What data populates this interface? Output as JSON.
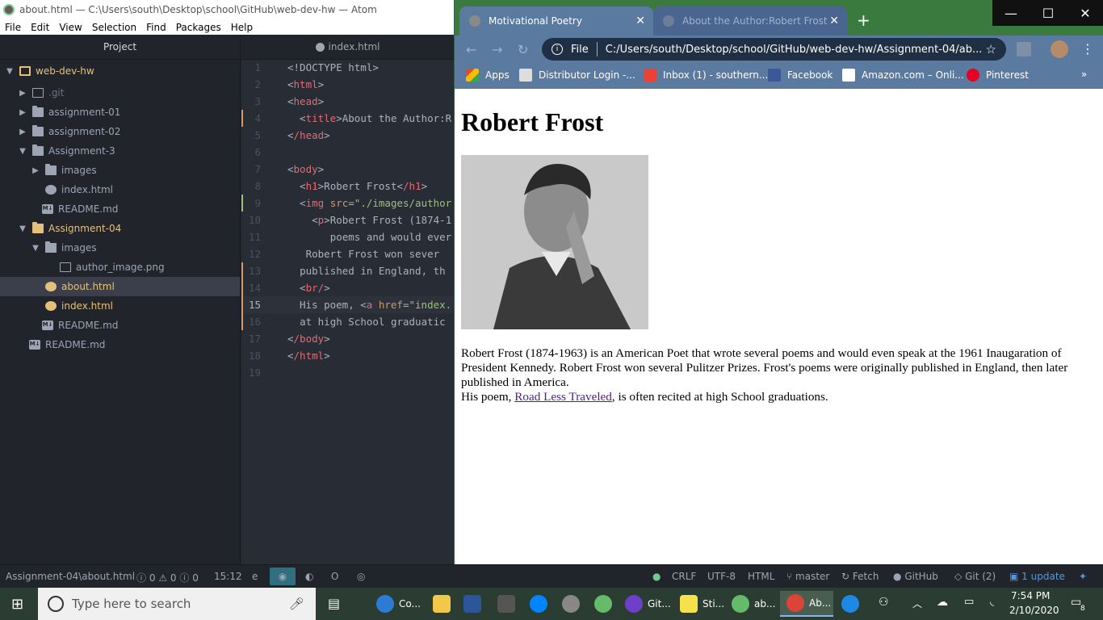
{
  "atom": {
    "title": "about.html — C:\\Users\\south\\Desktop\\school\\GitHub\\web-dev-hw — Atom",
    "menu": [
      "File",
      "Edit",
      "View",
      "Selection",
      "Find",
      "Packages",
      "Help"
    ],
    "tree_header": "Project",
    "tree": [
      {
        "label": "web-dev-hw"
      },
      {
        "label": ".git"
      },
      {
        "label": "assignment-01"
      },
      {
        "label": "assignment-02"
      },
      {
        "label": "Assignment-3"
      },
      {
        "label": "images"
      },
      {
        "label": "index.html"
      },
      {
        "label": "README.md"
      },
      {
        "label": "Assignment-04"
      },
      {
        "label": "images"
      },
      {
        "label": "author_image.png"
      },
      {
        "label": "about.html"
      },
      {
        "label": "index.html"
      },
      {
        "label": "README.md"
      },
      {
        "label": "README.md"
      }
    ],
    "editor_tab": "index.html",
    "line_numbers": [
      "1",
      "2",
      "3",
      "4",
      "5",
      "6",
      "7",
      "8",
      "9",
      "10",
      "11",
      "12",
      "13",
      "14",
      "15",
      "16",
      "17",
      "18",
      "19"
    ],
    "code": {
      "l1": "<!DOCTYPE html>",
      "l2_tag": "html",
      "l3_tag": "head",
      "l4_tag": "title",
      "l4_text": "About the Author:R",
      "l5_tag": "/head",
      "l7_tag": "body",
      "l8_tag": "h1",
      "l8_text": "Robert Frost",
      "l8_end": "/h1",
      "l9_tag": "img",
      "l9_attr": "src",
      "l9_str": "\"./images/author",
      "l10_tag": "p",
      "l10_text": "Robert Frost (1874-1",
      "l11_text": "poems and would ever",
      "l12_text": "Robert Frost won sever",
      "l13_text": "published in England, th",
      "l14_tag": "br/",
      "l15_text": "His poem, ",
      "l15_tag": "a",
      "l15_attr": "href",
      "l15_str": "\"index.",
      "l16_text": "at high School graduatic",
      "l17_tag": "/body",
      "l18_tag": "/html"
    }
  },
  "status": {
    "path": "Assignment-04\\about.html",
    "errors": "0",
    "warnings": "0",
    "infos": "0",
    "cursor": "15:12",
    "line_ending": "CRLF",
    "encoding": "UTF-8",
    "grammar": "HTML",
    "branch": "master",
    "fetch": "Fetch",
    "github": "GitHub",
    "git": "Git (2)",
    "updates": "1 update"
  },
  "chrome": {
    "tabs": [
      {
        "title": "Motivational Poetry"
      },
      {
        "title": "About the Author:Robert Frost"
      }
    ],
    "file_label": "File",
    "url": "C:/Users/south/Desktop/school/GitHub/web-dev-hw/Assignment-04/ab...",
    "bookmarks": [
      "Apps",
      "Distributor Login -...",
      "Inbox (1) - southern...",
      "Facebook",
      "Amazon.com – Onli...",
      "Pinterest"
    ],
    "overflow": "»"
  },
  "page": {
    "heading": "Robert Frost",
    "paragraph_start": "Robert Frost (1874-1963) is an American Poet that wrote several poems and would even speak at the 1961 Inaugaration of President Kennedy. Robert Frost won several Pulitzer Prizes. Frost's poems were originally published in England, then later published in America.",
    "paragraph_poem_prefix": "His poem, ",
    "link_text": "Road Less Traveled",
    "paragraph_poem_suffix": ", is often recited at high School graduations."
  },
  "taskbar": {
    "search_placeholder": "Type here to search",
    "apps": [
      "Co...",
      "Git...",
      "Sti...",
      "ab...",
      "Ab..."
    ],
    "time": "7:54 PM",
    "date": "2/10/2020",
    "notifications": "8"
  }
}
